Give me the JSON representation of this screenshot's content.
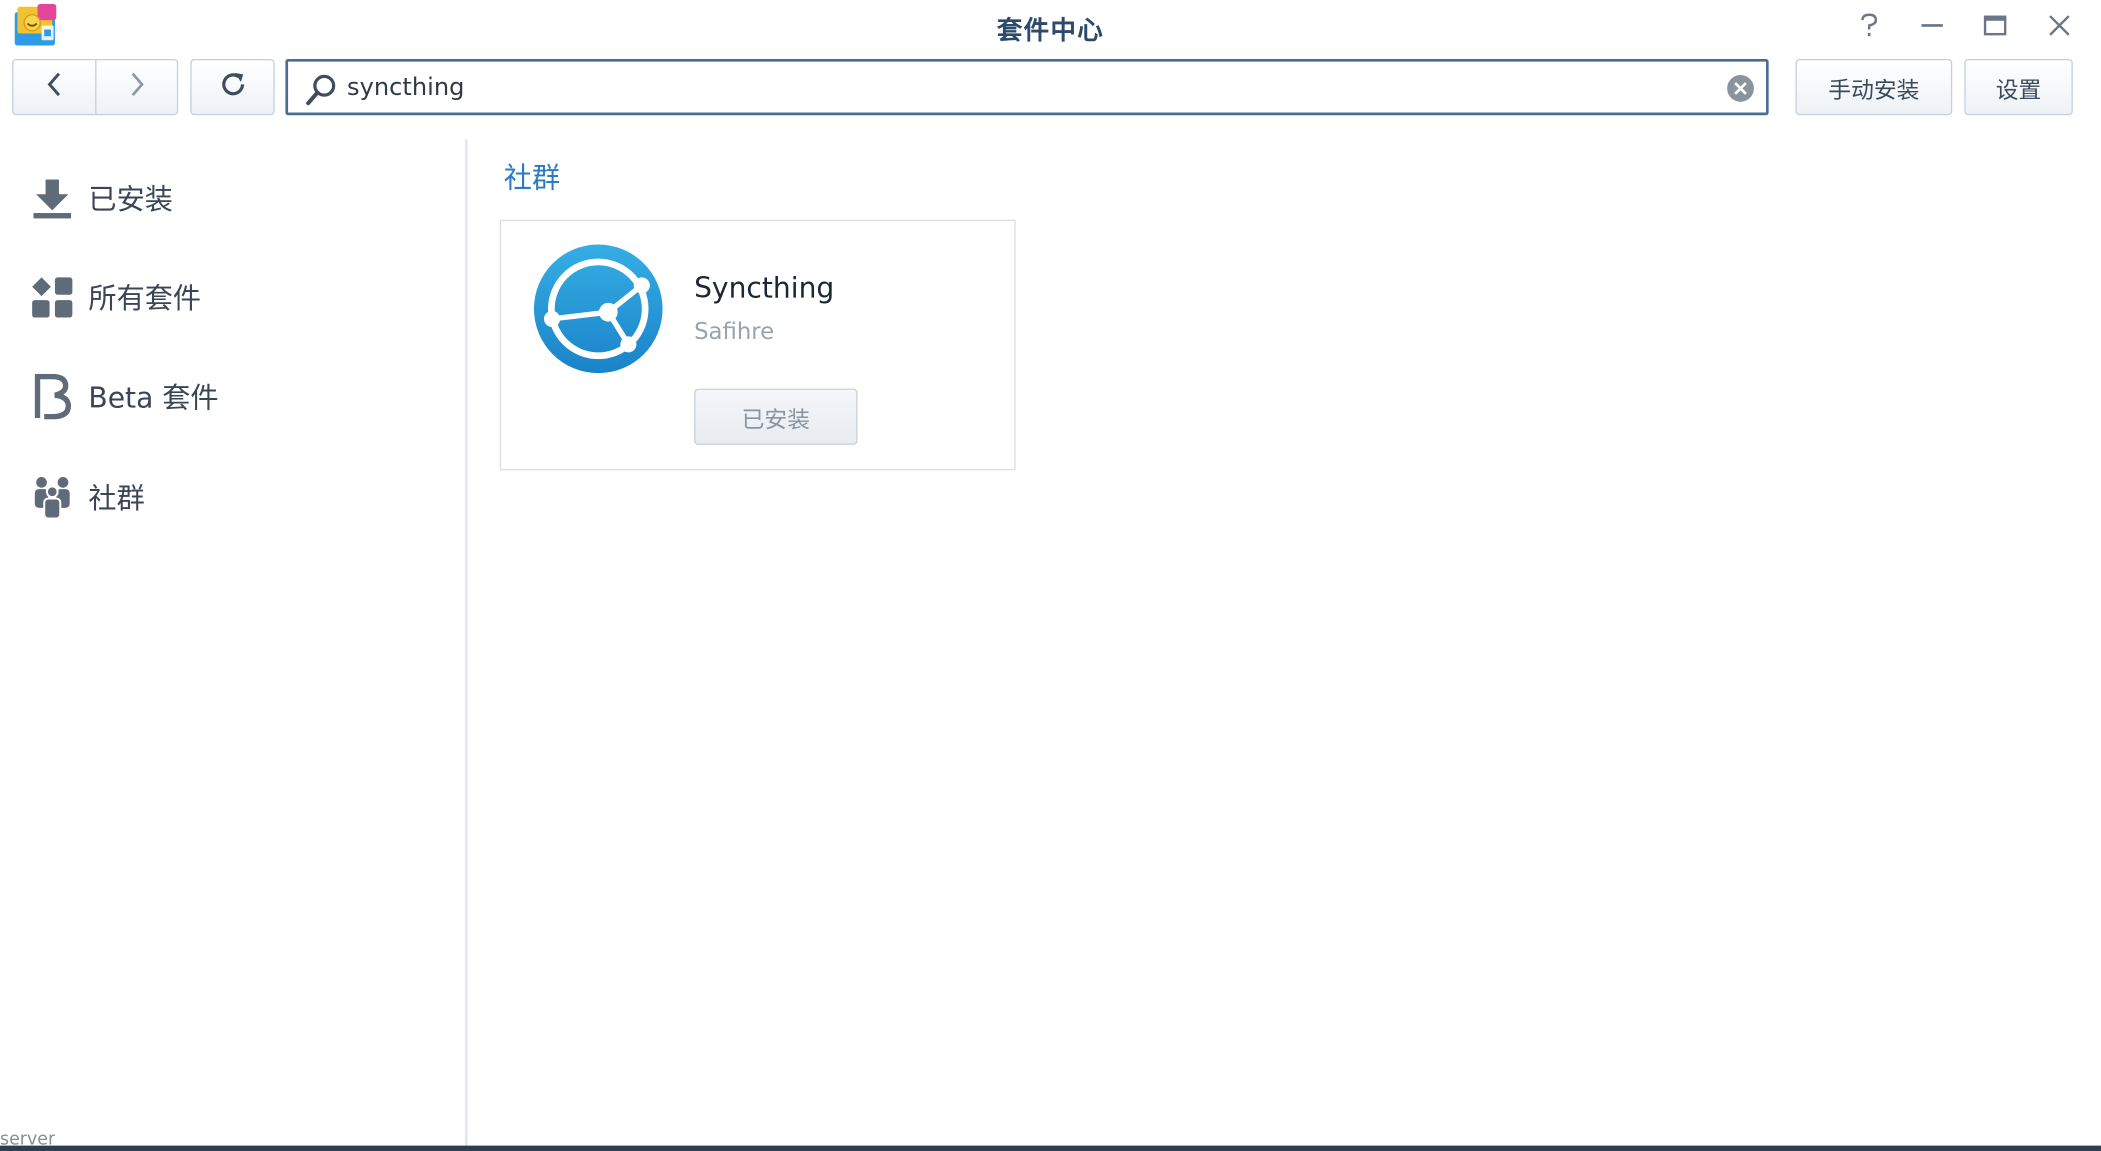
{
  "window": {
    "title": "套件中心",
    "controls": [
      "help-icon",
      "minimize-icon",
      "maximize-icon",
      "close-icon"
    ]
  },
  "toolbar": {
    "back_icon": "chevron-left-icon",
    "forward_icon": "chevron-right-icon",
    "refresh_icon": "refresh-icon",
    "search": {
      "value": "syncthing",
      "icon": "search-icon",
      "clear_icon": "clear-icon"
    },
    "manual_install_label": "手动安装",
    "settings_label": "设置"
  },
  "sidebar": {
    "items": [
      {
        "label": "已安装",
        "icon": "download-icon"
      },
      {
        "label": "所有套件",
        "icon": "grid-icon"
      },
      {
        "label": "Beta 套件",
        "icon": "beta-icon"
      },
      {
        "label": "社群",
        "icon": "community-icon"
      }
    ]
  },
  "main": {
    "section_title": "社群",
    "packages": [
      {
        "name": "Syncthing",
        "author": "Safihre",
        "status": "已安装",
        "icon": "syncthing-logo-icon"
      }
    ]
  },
  "footer": {
    "text": "server"
  },
  "colors": {
    "title": "#2d4a6b",
    "accent": "#2b7bc0",
    "search_border": "#4a6d94",
    "footer_bar": "#2c3d52"
  }
}
